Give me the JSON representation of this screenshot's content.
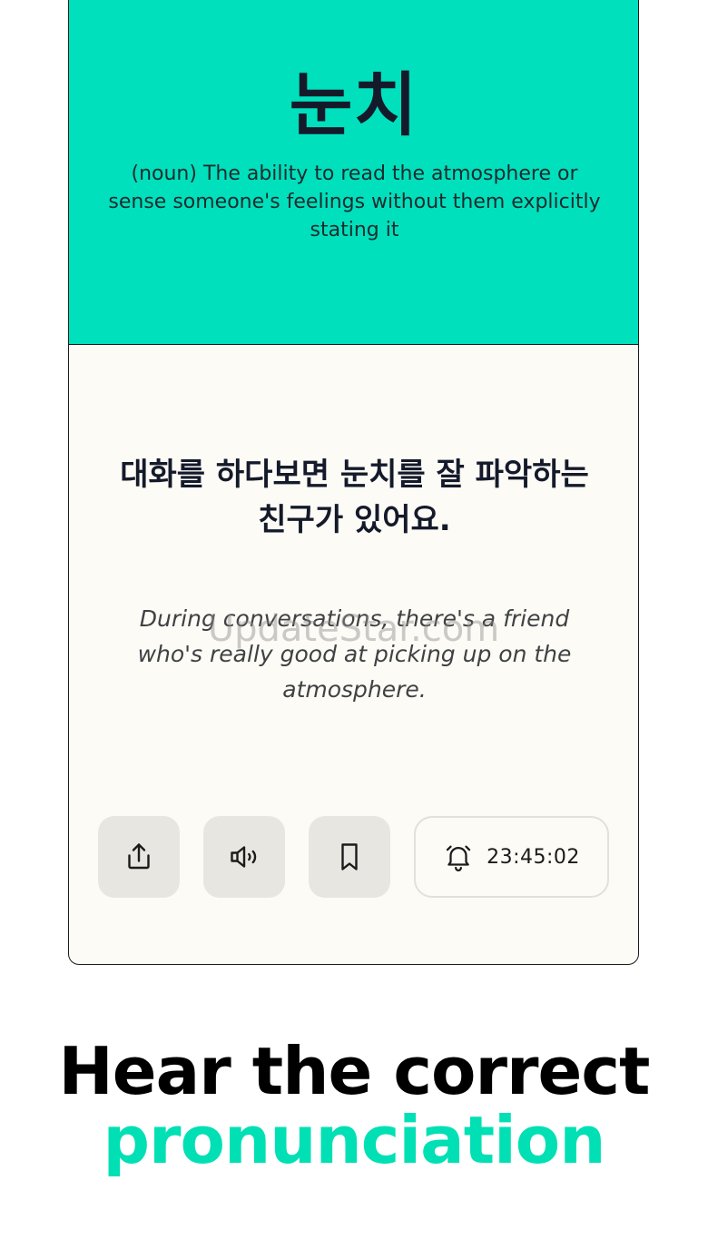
{
  "card": {
    "word": "눈치",
    "definition": "(noun) The ability to read the atmosphere or sense someone's feelings without them explicitly stating it",
    "example_korean": "대화를 하다보면 눈치를 잘 파악하는 친구가 있어요.",
    "example_english": "During conversations, there's a friend who's really good at picking up on the atmosphere."
  },
  "actions": {
    "share_icon": "share-icon",
    "speaker_icon": "speaker-icon",
    "bookmark_icon": "bookmark-icon",
    "alarm_icon": "bell-icon",
    "timer": "23:45:02"
  },
  "watermark": "UpdateStar.com",
  "caption": {
    "line1": "Hear the correct",
    "line2": "pronunciation"
  },
  "colors": {
    "accent": "#00e0bd",
    "card_background": "#fdfbf6",
    "button_background": "#e8e6e0"
  }
}
